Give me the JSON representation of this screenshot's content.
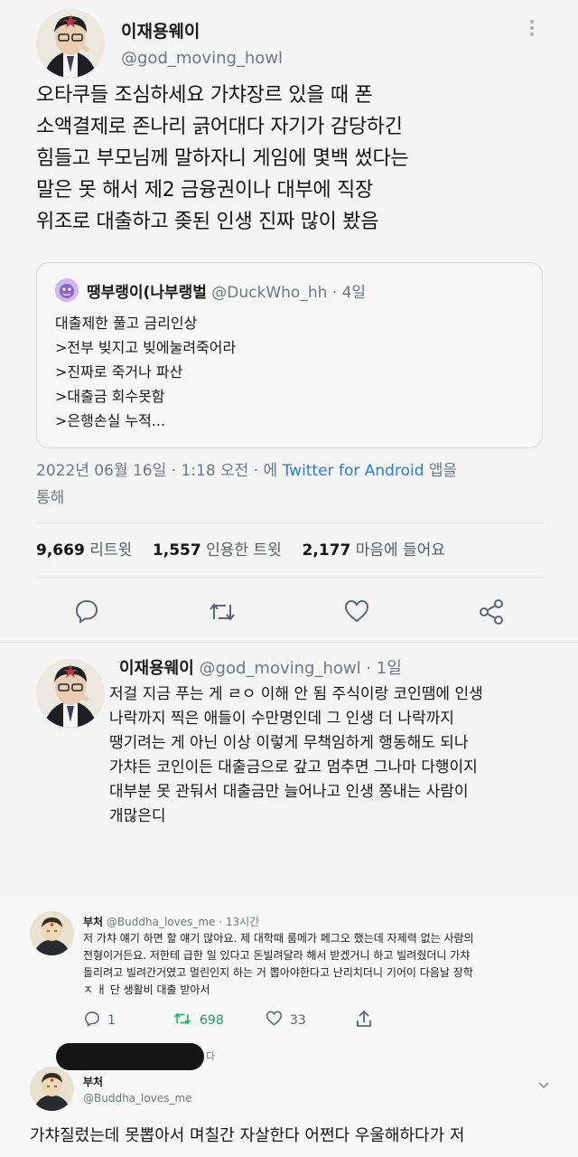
{
  "main_tweet": {
    "author_name": "이재용웨이",
    "author_handle": "@god_moving_howl",
    "text_lines": [
      "오타쿠들 조심하세요 가챠장르 있을 때 폰",
      "소액결제로 존나리 긁어대다 자기가 감당하긴",
      "힘들고 부모님께 말하자니 게임에 몇백 썼다는",
      "말은 못 해서 제2 금융권이나 대부에 직장",
      "위조로 대출하고 좆된 인생 진짜 많이 봤음"
    ],
    "quote": {
      "author_name": "땡부랭이(나부랭벌",
      "author_handle": "@DuckWho_hh",
      "time": "· 4일",
      "lines": [
        "대출제한 풀고 금리인상",
        ">전부 빚지고 빚에눌려죽어라",
        ">진짜로 죽거나 파산",
        ">대출금 회수못함",
        ">은행손실 누적..."
      ]
    },
    "meta_prefix": "2022년 06월 16일 · 1:18 오전 · 에 ",
    "meta_client": "Twitter for Android",
    "meta_suffix": " 앱을",
    "meta_line2": "통해",
    "stats": {
      "retweets_num": "9,669",
      "retweets_label": "리트윗",
      "quotes_num": "1,557",
      "quotes_label": "인용한 트윗",
      "likes_num": "2,177",
      "likes_label": "마음에 들어요"
    },
    "icons": [
      "reply-icon",
      "retweet-icon",
      "like-icon",
      "share-icon"
    ]
  },
  "reply_tweet": {
    "author_name": "이재용웨이",
    "author_handle": "@god_moving_howl",
    "time": "· 1일",
    "text_lines": [
      "저걸 지금 푸는 게 ㄹㅇ 이해 안 됨 주식이랑 코인땜에 인생",
      "나락까지 찍은 애들이 수만명인데 그 인생 더 나락까지",
      "땡기려는 게 아닌 이상 이렇게 무책임하게 행동해도 되나",
      "가챠든 코인이든 대출금으로 갚고 멈추면 그나마 다행이지",
      "대부분 못 관둬서 대출금만 늘어나고 인생 쫑내는 사람이",
      "개많은디"
    ]
  },
  "screenshot_tweet": {
    "author_name": "부처",
    "author_handle": "@Buddha_loves_me",
    "time": "· 13시간",
    "text_lines": [
      "저 가챠 얘기 하면 할 얘기 많아요. 제 대학때 룸메가 페그오 했는데 자제력 없는 사람의",
      "전형이거든요. 저한테 급한 일 있다고 돈빌려달라 해서 받겠거니 하고 빌려줬더니 가챠",
      "돌리려고 빌려간거였고 멀린인지 하는 거 뽑아야한다고 난리치더니 기어이 다음날 장학",
      "ㅈ ㅐ 단 생활비 대출 받아서"
    ],
    "reply_count": "1",
    "retweet_count": "698",
    "like_count": "33",
    "censored_suffix": "다"
  },
  "bottom_tweet": {
    "author_name": "부처",
    "author_handle": "@Buddha_loves_me",
    "text_line1": "가챠질렀는데 못뽑아서 며칠간 자살한다 어쩐다 우울해하다가 저"
  },
  "colors": {
    "background": "#f4f4f4",
    "link": "#2a7fc7",
    "retweet_green": "#17bf63",
    "muted": "#6f7780"
  }
}
